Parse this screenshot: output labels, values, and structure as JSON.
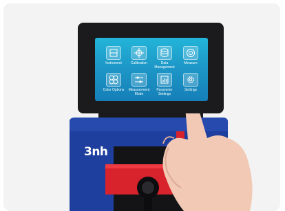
{
  "screen": {
    "apps": [
      {
        "label": "Instrument",
        "icon": "instrument-icon"
      },
      {
        "label": "Calibration",
        "icon": "crosshair-icon"
      },
      {
        "label": "Data\nManagement",
        "icon": "database-icon"
      },
      {
        "label": "Measure",
        "icon": "target-icon"
      },
      {
        "label": "Color Options",
        "icon": "color-options-icon"
      },
      {
        "label": "Measurement\nMode",
        "icon": "sliders-icon"
      },
      {
        "label": "Parameter\nSettings",
        "icon": "chart-icon"
      },
      {
        "label": "Settings",
        "icon": "gear-icon"
      }
    ]
  },
  "device": {
    "brand": "3nh"
  },
  "colors": {
    "device_blue": "#1f3f9e",
    "screen_blue": "#1d98c8",
    "accent_red": "#d8232c",
    "bezel": "#1b1b1d"
  }
}
